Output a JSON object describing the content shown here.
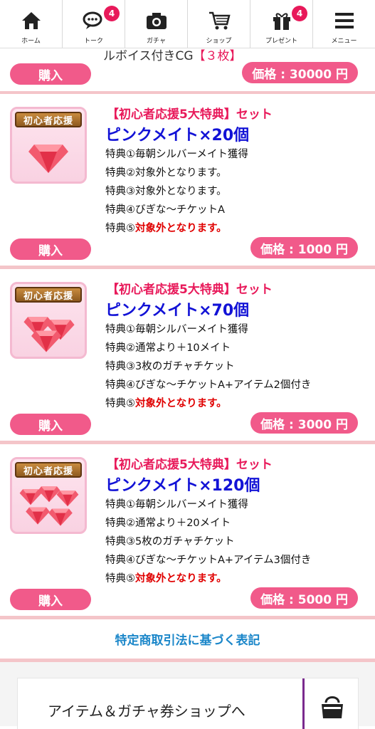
{
  "nav": {
    "items": [
      {
        "label": "ホーム",
        "icon": "home-icon"
      },
      {
        "label": "トーク",
        "icon": "chat-icon",
        "badge": "4"
      },
      {
        "label": "ガチャ",
        "icon": "camera-icon"
      },
      {
        "label": "ショップ",
        "icon": "cart-icon"
      },
      {
        "label": "プレゼント",
        "icon": "gift-icon",
        "badge": "4"
      },
      {
        "label": "メニュー",
        "icon": "menu-icon"
      }
    ]
  },
  "top_item": {
    "partial_text": "ルボイス付きCG",
    "partial_highlight": "【３枚】",
    "buy_label": "購入",
    "price": "価格 : 30000 円"
  },
  "products": [
    {
      "thumb_badge": "初心者応援",
      "tag": "【初心者応援5大特典】セット",
      "name": "ピンクメイト×20個",
      "benefits": [
        {
          "prefix": "特典①",
          "text": "毎朝シルバーメイト獲得"
        },
        {
          "prefix": "特典②",
          "text": "対象外となります。"
        },
        {
          "prefix": "特典③",
          "text": "対象外となります。"
        },
        {
          "prefix": "特典④",
          "text": "びぎな～チケットA"
        },
        {
          "prefix": "特典⑤",
          "text": "対象外となります。",
          "red": true
        }
      ],
      "buy_label": "購入",
      "price": "価格 : 1000 円",
      "gems": 1
    },
    {
      "thumb_badge": "初心者応援",
      "tag": "【初心者応援5大特典】セット",
      "name": "ピンクメイト×70個",
      "benefits": [
        {
          "prefix": "特典①",
          "text": "毎朝シルバーメイト獲得"
        },
        {
          "prefix": "特典②",
          "text": "通常より＋10メイト"
        },
        {
          "prefix": "特典③",
          "text": "3枚のガチャチケット"
        },
        {
          "prefix": "特典④",
          "text": "びぎな～チケットA+アイテム2個付き"
        },
        {
          "prefix": "特典⑤",
          "text": "対象外となります。",
          "red": true
        }
      ],
      "buy_label": "購入",
      "price": "価格 : 3000 円",
      "gems": 3
    },
    {
      "thumb_badge": "初心者応援",
      "tag": "【初心者応援5大特典】セット",
      "name": "ピンクメイト×120個",
      "benefits": [
        {
          "prefix": "特典①",
          "text": "毎朝シルバーメイト獲得"
        },
        {
          "prefix": "特典②",
          "text": "通常より＋20メイト"
        },
        {
          "prefix": "特典③",
          "text": "5枚のガチャチケット"
        },
        {
          "prefix": "特典④",
          "text": "びぎな～チケットA+アイテム3個付き"
        },
        {
          "prefix": "特典⑤",
          "text": "対象外となります。",
          "red": true
        }
      ],
      "buy_label": "購入",
      "price": "価格 : 5000 円",
      "gems": 5
    }
  ],
  "legal": {
    "link": "特定商取引法に基づく表記"
  },
  "shop_link": {
    "label": "アイテム＆ガチャ券ショップへ",
    "icon": "bag-icon"
  },
  "colors": {
    "accent": "#f15a8a",
    "tag_red": "#e8195a",
    "name_blue": "#1212d6",
    "link_blue": "#1a86c9",
    "divider": "#f4c5c9"
  }
}
